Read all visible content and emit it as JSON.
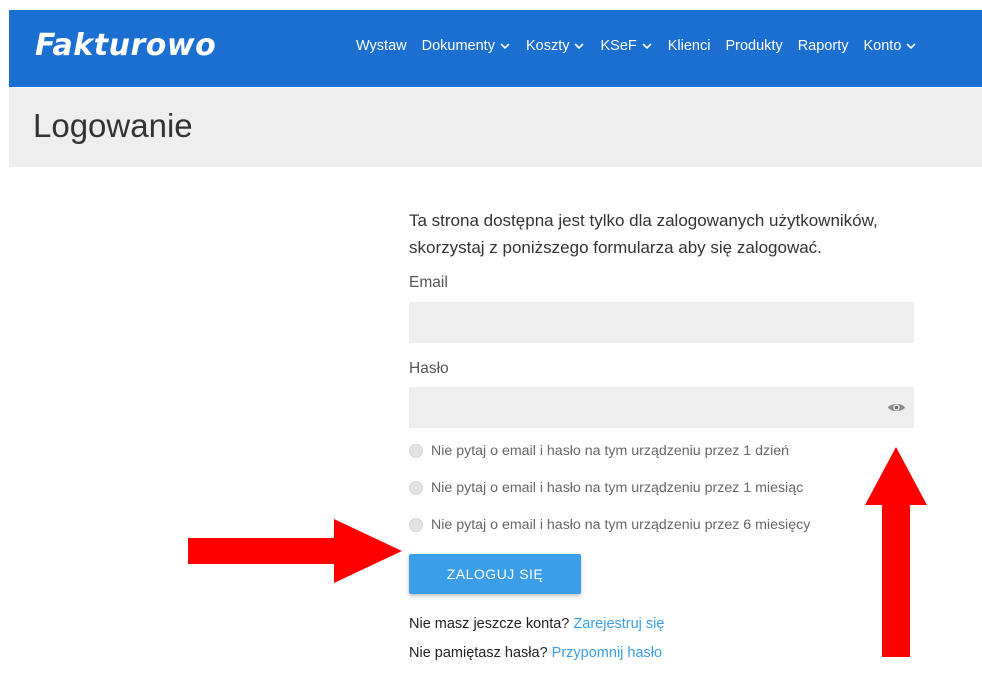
{
  "header": {
    "logo": "Fakturowo",
    "nav": [
      {
        "label": "Wystaw",
        "dropdown": false
      },
      {
        "label": "Dokumenty",
        "dropdown": true
      },
      {
        "label": "Koszty",
        "dropdown": true
      },
      {
        "label": "KSeF",
        "dropdown": true
      },
      {
        "label": "Klienci",
        "dropdown": false
      },
      {
        "label": "Produkty",
        "dropdown": false
      },
      {
        "label": "Raporty",
        "dropdown": false
      },
      {
        "label": "Konto",
        "dropdown": true
      }
    ]
  },
  "page": {
    "title": "Logowanie"
  },
  "form": {
    "intro": "Ta strona dostępna jest tylko dla zalogowanych użytkowników, skorzystaj z poniższego formularza aby się zalogować.",
    "email_label": "Email",
    "email_value": "",
    "password_label": "Hasło",
    "password_value": "",
    "remember_options": [
      "Nie pytaj o email i hasło na tym urządzeniu przez 1 dzień",
      "Nie pytaj o email i hasło na tym urządzeniu przez 1 miesiąc",
      "Nie pytaj o email i hasło na tym urządzeniu przez 6 miesięcy"
    ],
    "submit_label": "ZALOGUJ SIĘ",
    "register_prompt": "Nie masz jeszcze konta?",
    "register_link": "Zarejestruj się",
    "forgot_prompt": "Nie pamiętasz hasła?",
    "forgot_link": "Przypomnij hasło"
  },
  "colors": {
    "brand": "#1a6fd0",
    "accent": "#3b9ee8",
    "annotation": "#ff0000"
  },
  "icons": {
    "password_toggle": "eye-icon",
    "dropdown": "chevron-down-icon",
    "annotations": [
      "arrow-right-icon",
      "arrow-up-icon"
    ]
  }
}
